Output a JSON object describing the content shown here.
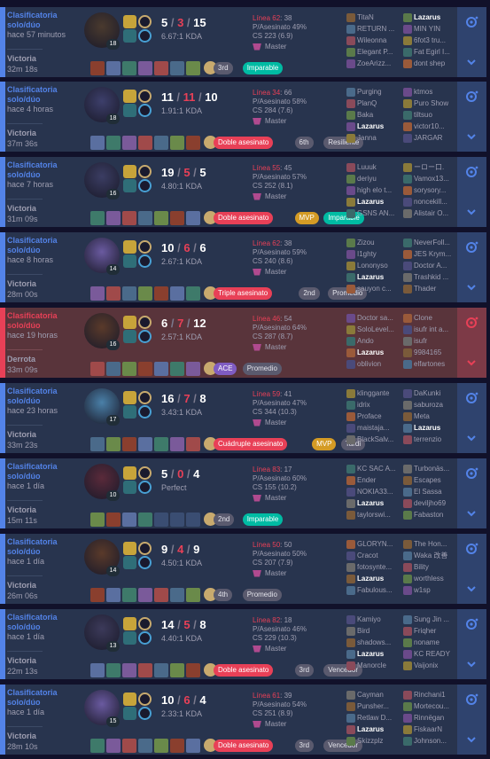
{
  "labels": {
    "kda_suffix": "KDA",
    "rank_master": "Master"
  },
  "colors": {
    "win": "#5383e8",
    "loss": "#e84057",
    "win_bg": "#28344e",
    "loss_bg": "#59343b"
  },
  "matches": [
    {
      "result": "win",
      "queue": "Clasificatoria solo/dúo",
      "ago": "hace 57 minutos",
      "result_label": "Victoria",
      "duration": "32m 18s",
      "level": "18",
      "k": "5",
      "d": "3",
      "a": "15",
      "kda": "6.67:1 KDA",
      "lp_line": "Línea 62",
      "lp_value": ": 38",
      "kill_participation": "P/Asesinato 49%",
      "cs": "CS 223 (6.9)",
      "rank": "Master",
      "badges": [
        {
          "label": "3rd",
          "style": "gray"
        },
        {
          "label": "Imparable",
          "style": "green"
        }
      ],
      "team1": [
        "TitaN",
        "RETURN ...",
        "Wileonna",
        "Elegant P...",
        "ZoeArizz..."
      ],
      "team2": [
        "Lazarus",
        "MIN YIN",
        "6fot3 tru...",
        "Fat Egirl I...",
        "dont shep"
      ]
    },
    {
      "result": "win",
      "queue": "Clasificatoria solo/dúo",
      "ago": "hace 4 horas",
      "result_label": "Victoria",
      "duration": "37m 36s",
      "level": "18",
      "k": "11",
      "d": "11",
      "a": "10",
      "kda": "1.91:1 KDA",
      "lp_line": "Línea 34",
      "lp_value": ": 66",
      "kill_participation": "P/Asesinato 58%",
      "cs": "CS 284 (7.6)",
      "rank": "Master",
      "badges": [
        {
          "label": "Doble asesinato",
          "style": "red"
        },
        {
          "label": "6th",
          "style": "gray"
        },
        {
          "label": "Resiliente",
          "style": "gray"
        }
      ],
      "team1": [
        "Purging",
        "PlanQ",
        "Baka",
        "Lazarus",
        "Janna"
      ],
      "team2": [
        "ktmos",
        "Puro Show",
        "tiltsuo",
        "victor10...",
        "JARGAR"
      ]
    },
    {
      "result": "win",
      "queue": "Clasificatoria solo/dúo",
      "ago": "hace 7 horas",
      "result_label": "Victoria",
      "duration": "31m 09s",
      "level": "16",
      "k": "19",
      "d": "5",
      "a": "5",
      "kda": "4.80:1 KDA",
      "lp_line": "Línea 55",
      "lp_value": ": 45",
      "kill_participation": "P/Asesinato 57%",
      "cs": "CS 252 (8.1)",
      "rank": "Master",
      "badges": [
        {
          "label": "Doble asesinato",
          "style": "red"
        },
        {
          "label": "MVP",
          "style": "gold"
        },
        {
          "label": "Imparable",
          "style": "green"
        }
      ],
      "team1": [
        "Luuuk",
        "deriyu",
        "high elo t...",
        "Lazarus",
        "GSNS AN..."
      ],
      "team2": [
        "ーロー口.",
        "Vamox13...",
        "sorysory...",
        "noncekill...",
        "Alistair O..."
      ]
    },
    {
      "result": "win",
      "queue": "Clasificatoria solo/dúo",
      "ago": "hace 8 horas",
      "result_label": "Victoria",
      "duration": "28m 00s",
      "level": "14",
      "k": "10",
      "d": "6",
      "a": "6",
      "kda": "2.67:1 KDA",
      "lp_line": "Línea 62",
      "lp_value": ": 38",
      "kill_participation": "P/Asesinato 59%",
      "cs": "CS 240 (8.6)",
      "rank": "Master",
      "badges": [
        {
          "label": "Triple asesinato",
          "style": "red"
        },
        {
          "label": "2nd",
          "style": "gray"
        },
        {
          "label": "Promedio",
          "style": "gray"
        }
      ],
      "team1": [
        "Zizou",
        "I1ghty",
        "Lononyso",
        "Lazarus",
        "sauyon c..."
      ],
      "team2": [
        "NeverFoll...",
        "JES Krym...",
        "Doctor A...",
        "Trashkid ...",
        "Thader"
      ]
    },
    {
      "result": "loss",
      "queue": "Clasificatoria solo/dúo",
      "ago": "hace 19 horas",
      "result_label": "Derrota",
      "duration": "33m 09s",
      "level": "16",
      "k": "6",
      "d": "7",
      "a": "12",
      "kda": "2.57:1 KDA",
      "lp_line": "Línea 46",
      "lp_value": ": 54",
      "kill_participation": "P/Asesinato 64%",
      "cs": "CS 287 (8.7)",
      "rank": "Master",
      "badges": [
        {
          "label": "ACE",
          "style": "purple"
        },
        {
          "label": "Promedio",
          "style": "gray"
        }
      ],
      "team1": [
        "Doctor sa...",
        "SoloLevel...",
        "Ando",
        "Lazarus",
        "oblivion"
      ],
      "team2": [
        "Clone",
        "isufr int a...",
        "isufr",
        "9984165",
        "elfartones"
      ]
    },
    {
      "result": "win",
      "queue": "Clasificatoria solo/dúo",
      "ago": "hace 23 horas",
      "result_label": "Victoria",
      "duration": "33m 23s",
      "level": "17",
      "k": "16",
      "d": "7",
      "a": "8",
      "kda": "3.43:1 KDA",
      "lp_line": "Línea 59",
      "lp_value": ": 41",
      "kill_participation": "P/Asesinato 47%",
      "cs": "CS 344 (10.3)",
      "rank": "Master",
      "badges": [
        {
          "label": "Cuádruple asesinato",
          "style": "red"
        },
        {
          "label": "MVP",
          "style": "gold"
        },
        {
          "label": "Tardi",
          "style": "gray"
        }
      ],
      "team1": [
        "klinggante",
        "idrix",
        "Proface",
        "maistaja...",
        "BlackSalv..."
      ],
      "team2": [
        "DaKunki",
        "saburoza",
        "Meta",
        "Lazarus",
        "terrenzio"
      ]
    },
    {
      "result": "win",
      "queue": "Clasificatoria solo/dúo",
      "ago": "hace 1 día",
      "result_label": "Victoria",
      "duration": "15m 11s",
      "level": "10",
      "k": "5",
      "d": "0",
      "a": "4",
      "kda": "Perfect",
      "lp_line": "Línea 83",
      "lp_value": ": 17",
      "kill_participation": "P/Asesinato 60%",
      "cs": "CS 155 (10.2)",
      "rank": "Master",
      "badges": [
        {
          "label": "2nd",
          "style": "gray"
        },
        {
          "label": "Imparable",
          "style": "green"
        }
      ],
      "team1": [
        "KC SAC A...",
        "Ender",
        "NOKIA33...",
        "Lazarus",
        "taylorswi..."
      ],
      "team2": [
        "Turbonäs...",
        "Escapes",
        "El Sassa",
        "deviljho69",
        "Fabaston"
      ]
    },
    {
      "result": "win",
      "queue": "Clasificatoria solo/dúo",
      "ago": "hace 1 día",
      "result_label": "Victoria",
      "duration": "26m 06s",
      "level": "14",
      "k": "9",
      "d": "4",
      "a": "9",
      "kda": "4.50:1 KDA",
      "lp_line": "Línea 50",
      "lp_value": ": 50",
      "kill_participation": "P/Asesinato 50%",
      "cs": "CS 207 (7.9)",
      "rank": "Master",
      "badges": [
        {
          "label": "4th",
          "style": "gray"
        },
        {
          "label": "Promedio",
          "style": "gray"
        }
      ],
      "team1": [
        "GLORYN...",
        "Cracot",
        "fotosynte...",
        "Lazarus",
        "Fabulous..."
      ],
      "team2": [
        "The Hon...",
        "Waka 改善",
        "Bility",
        "worthless",
        "w1sp"
      ]
    },
    {
      "result": "win",
      "queue": "Clasificatoria solo/dúo",
      "ago": "hace 1 día",
      "result_label": "Victoria",
      "duration": "22m 13s",
      "level": "13",
      "k": "14",
      "d": "5",
      "a": "8",
      "kda": "4.40:1 KDA",
      "lp_line": "Línea 82",
      "lp_value": ": 18",
      "kill_participation": "P/Asesinato 46%",
      "cs": "CS 229 (10.3)",
      "rank": "Master",
      "badges": [
        {
          "label": "Doble asesinato",
          "style": "red"
        },
        {
          "label": "3rd",
          "style": "gray"
        },
        {
          "label": "Vencedor",
          "style": "gray"
        }
      ],
      "team1": [
        "Kamiyo",
        "Bird",
        "shadows...",
        "Lazarus",
        "Manorcle"
      ],
      "team2": [
        "Sung Jin ...",
        "Friqher",
        "noname",
        "KC READY",
        "Vaijonix"
      ]
    },
    {
      "result": "win",
      "queue": "Clasificatoria solo/dúo",
      "ago": "hace 1 día",
      "result_label": "Victoria",
      "duration": "28m 10s",
      "level": "15",
      "k": "10",
      "d": "6",
      "a": "4",
      "kda": "2.33:1 KDA",
      "lp_line": "Línea 61",
      "lp_value": ": 39",
      "kill_participation": "P/Asesinato 54%",
      "cs": "CS 251 (8.9)",
      "rank": "Master",
      "badges": [
        {
          "label": "Doble asesinato",
          "style": "red"
        },
        {
          "label": "3rd",
          "style": "gray"
        },
        {
          "label": "Vencedor",
          "style": "gray"
        }
      ],
      "team1": [
        "Cayman",
        "Punsher...",
        "Retlaw D...",
        "Lazarus",
        "Skizzplz"
      ],
      "team2": [
        "Rinchani1",
        "Mortecou...",
        "Rinnëgan",
        "FiskaarN",
        "Johnson..."
      ]
    }
  ]
}
